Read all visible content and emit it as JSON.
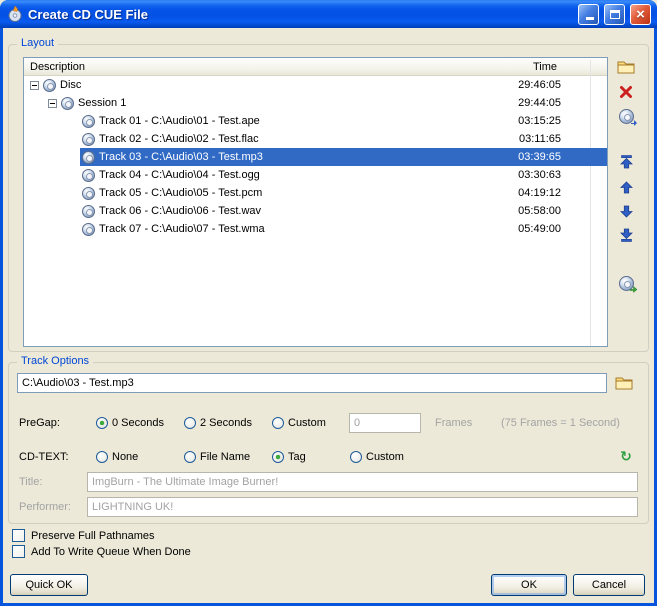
{
  "window": {
    "title": "Create CD CUE File",
    "controls": [
      "minimize",
      "maximize",
      "close"
    ]
  },
  "layout": {
    "label": "Layout",
    "header": {
      "description": "Description",
      "time": "Time"
    },
    "rows": [
      {
        "type": "disc",
        "label": "Disc",
        "time": "29:46:05",
        "selected": false
      },
      {
        "type": "session",
        "label": "Session 1",
        "time": "29:44:05",
        "selected": false
      },
      {
        "type": "track",
        "label": "Track 01 - C:\\Audio\\01 - Test.ape",
        "time": "03:15:25",
        "selected": false
      },
      {
        "type": "track",
        "label": "Track 02 - C:\\Audio\\02 - Test.flac",
        "time": "03:11:65",
        "selected": false
      },
      {
        "type": "track",
        "label": "Track 03 - C:\\Audio\\03 - Test.mp3",
        "time": "03:39:65",
        "selected": true
      },
      {
        "type": "track",
        "label": "Track 04 - C:\\Audio\\04 - Test.ogg",
        "time": "03:30:63",
        "selected": false
      },
      {
        "type": "track",
        "label": "Track 05 - C:\\Audio\\05 - Test.pcm",
        "time": "04:19:12",
        "selected": false
      },
      {
        "type": "track",
        "label": "Track 06 - C:\\Audio\\06 - Test.wav",
        "time": "05:58:00",
        "selected": false
      },
      {
        "type": "track",
        "label": "Track 07 - C:\\Audio\\07 - Test.wma",
        "time": "05:49:00",
        "selected": false
      }
    ],
    "toolbar_icons": [
      "add-files-folder-icon",
      "remove-icon",
      "disc-icon",
      "move-to-top-icon",
      "move-up-icon",
      "move-down-icon",
      "move-to-bottom-icon",
      "build-cue-disc-icon"
    ]
  },
  "track_options": {
    "label": "Track Options",
    "file_path": "C:\\Audio\\03 - Test.mp3",
    "pregap": {
      "label": "PreGap:",
      "options": [
        "0 Seconds",
        "2 Seconds",
        "Custom"
      ],
      "selected": "0 Seconds",
      "custom_value": "0",
      "frames_label": "Frames",
      "hint": "(75 Frames = 1 Second)"
    },
    "cdtext": {
      "label": "CD-TEXT:",
      "options": [
        "None",
        "File Name",
        "Tag",
        "Custom"
      ],
      "selected": "Tag"
    },
    "title_field": {
      "label": "Title:",
      "value": "ImgBurn - The Ultimate Image Burner!"
    },
    "performer_field": {
      "label": "Performer:",
      "value": "LIGHTNING UK!"
    }
  },
  "checkboxes": [
    {
      "label": "Preserve Full Pathnames",
      "checked": false
    },
    {
      "label": "Add To Write Queue When Done",
      "checked": false
    }
  ],
  "buttons": {
    "quick_ok": "Quick OK",
    "ok": "OK",
    "cancel": "Cancel"
  },
  "colors": {
    "titlebar_blue": "#0553E8",
    "selection": "#316AC5",
    "dialog_bg": "#ECE9D8",
    "group_caption": "#0046D5"
  }
}
